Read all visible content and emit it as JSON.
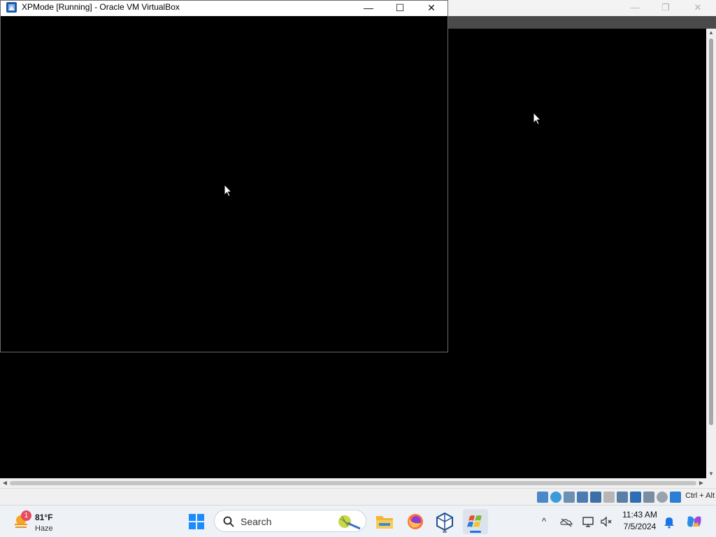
{
  "foreground_window": {
    "title": "XPMode [Running] - Oracle VM VirtualBox",
    "controls": {
      "minimize": "—",
      "maximize": "☐",
      "close": "✕"
    }
  },
  "background_window": {
    "controls": {
      "minimize": "—",
      "restore": "❐",
      "close": "✕"
    }
  },
  "status_bar": {
    "icons": [
      "hard-disk-icon",
      "optical-drive-icon",
      "audio-icon",
      "network-icon",
      "usb-icon",
      "shared-folders-icon",
      "display-icon",
      "video-capture-icon",
      "virtualization-icon",
      "cpu-icon",
      "mouse-integration-icon",
      "host-key-icon"
    ],
    "host_key": "Ctrl + Alt"
  },
  "taskbar": {
    "weather": {
      "badge": "1",
      "temperature": "81°F",
      "condition": "Haze"
    },
    "search": {
      "label": "Search"
    },
    "pinned_apps": [
      "windows-start-icon",
      "file-explorer-icon",
      "firefox-icon",
      "virtualbox-icon",
      "xp-mode-icon"
    ],
    "tray": {
      "overflow": "^"
    },
    "clock": {
      "time": "11:43 AM",
      "date": "7/5/2024"
    }
  }
}
